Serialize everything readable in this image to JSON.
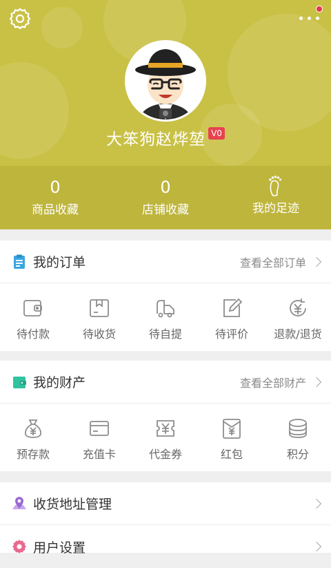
{
  "header": {
    "username": "大笨狗赵烨堃",
    "vip_level": "V0",
    "stats": [
      {
        "value": "0",
        "label": "商品收藏"
      },
      {
        "value": "0",
        "label": "店铺收藏"
      },
      {
        "label": "我的足迹"
      }
    ]
  },
  "orders": {
    "title": "我的订单",
    "view_all": "查看全部订单",
    "items": [
      {
        "label": "待付款",
        "icon": "wallet-icon"
      },
      {
        "label": "待收货",
        "icon": "package-icon"
      },
      {
        "label": "待自提",
        "icon": "truck-icon"
      },
      {
        "label": "待评价",
        "icon": "edit-icon"
      },
      {
        "label": "退款/退货",
        "icon": "refund-icon"
      }
    ]
  },
  "assets": {
    "title": "我的财产",
    "view_all": "查看全部财产",
    "items": [
      {
        "label": "预存款",
        "icon": "money-bag-icon"
      },
      {
        "label": "充值卡",
        "icon": "card-icon"
      },
      {
        "label": "代金券",
        "icon": "voucher-icon"
      },
      {
        "label": "红包",
        "icon": "red-envelope-icon"
      },
      {
        "label": "积分",
        "icon": "coins-icon"
      }
    ]
  },
  "menu": [
    {
      "label": "收货地址管理",
      "icon": "location-icon"
    },
    {
      "label": "用户设置",
      "icon": "gear-icon"
    }
  ],
  "colors": {
    "header_bg": "#c9c146",
    "accent_blue": "#3aa6e0",
    "accent_green": "#31c3a0",
    "accent_purple": "#9a6ad0",
    "badge_red": "#e8424f",
    "icon_gray": "#8c8c8c"
  }
}
